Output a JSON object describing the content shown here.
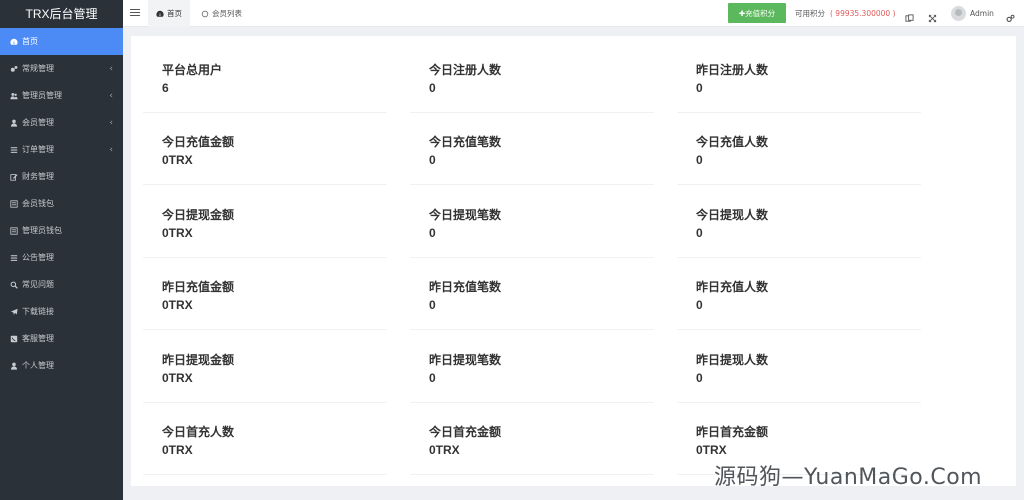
{
  "brand": "TRX后台管理",
  "sidebar": {
    "items": [
      {
        "label": "首页",
        "icon": "dashboard-icon",
        "active": true,
        "has_children": false
      },
      {
        "label": "常规管理",
        "icon": "cogs-icon",
        "active": false,
        "has_children": true
      },
      {
        "label": "管理员管理",
        "icon": "users-icon",
        "active": false,
        "has_children": true
      },
      {
        "label": "会员管理",
        "icon": "user-icon",
        "active": false,
        "has_children": true
      },
      {
        "label": "订单管理",
        "icon": "list-icon",
        "active": false,
        "has_children": true
      },
      {
        "label": "财务管理",
        "icon": "edit-icon",
        "active": false,
        "has_children": false
      },
      {
        "label": "会员钱包",
        "icon": "list-alt-icon",
        "active": false,
        "has_children": false
      },
      {
        "label": "管理员钱包",
        "icon": "list-alt-icon",
        "active": false,
        "has_children": false
      },
      {
        "label": "公告管理",
        "icon": "list-icon",
        "active": false,
        "has_children": false
      },
      {
        "label": "常见问题",
        "icon": "search-icon",
        "active": false,
        "has_children": false
      },
      {
        "label": "下载链接",
        "icon": "plane-icon",
        "active": false,
        "has_children": false
      },
      {
        "label": "客服管理",
        "icon": "phone-square-icon",
        "active": false,
        "has_children": false
      },
      {
        "label": "个人管理",
        "icon": "user-icon",
        "active": false,
        "has_children": false
      }
    ]
  },
  "topbar": {
    "tabs": [
      {
        "label": "首页",
        "icon": "dashboard-icon"
      },
      {
        "label": "会员列表",
        "icon": "circle-icon"
      }
    ],
    "recharge_label": "✚充值积分",
    "credits_label": "可用积分",
    "credits_value": "( 99935.300000 )",
    "username": "Admin"
  },
  "stats": [
    {
      "title": "平台总用户",
      "value": "6"
    },
    {
      "title": "今日注册人数",
      "value": "0"
    },
    {
      "title": "昨日注册人数",
      "value": "0"
    },
    {
      "title": "今日充值金额",
      "value": "0TRX"
    },
    {
      "title": "今日充值笔数",
      "value": "0"
    },
    {
      "title": "今日充值人数",
      "value": "0"
    },
    {
      "title": "今日提现金额",
      "value": "0TRX"
    },
    {
      "title": "今日提现笔数",
      "value": "0"
    },
    {
      "title": "今日提现人数",
      "value": "0"
    },
    {
      "title": "昨日充值金额",
      "value": "0TRX"
    },
    {
      "title": "昨日充值笔数",
      "value": "0"
    },
    {
      "title": "昨日充值人数",
      "value": "0"
    },
    {
      "title": "昨日提现金额",
      "value": "0TRX"
    },
    {
      "title": "昨日提现笔数",
      "value": "0"
    },
    {
      "title": "昨日提现人数",
      "value": "0"
    },
    {
      "title": "今日首充人数",
      "value": "0TRX"
    },
    {
      "title": "今日首充金额",
      "value": "0TRX"
    },
    {
      "title": "昨日首充金额",
      "value": "0TRX"
    }
  ],
  "watermark": "源码狗—YuanMaGo.Com",
  "colors": {
    "sidebar_bg": "#2a3138",
    "active_item": "#4c8bf5",
    "recharge_button": "#5cb85c",
    "credits_amount": "#e05a5a"
  }
}
